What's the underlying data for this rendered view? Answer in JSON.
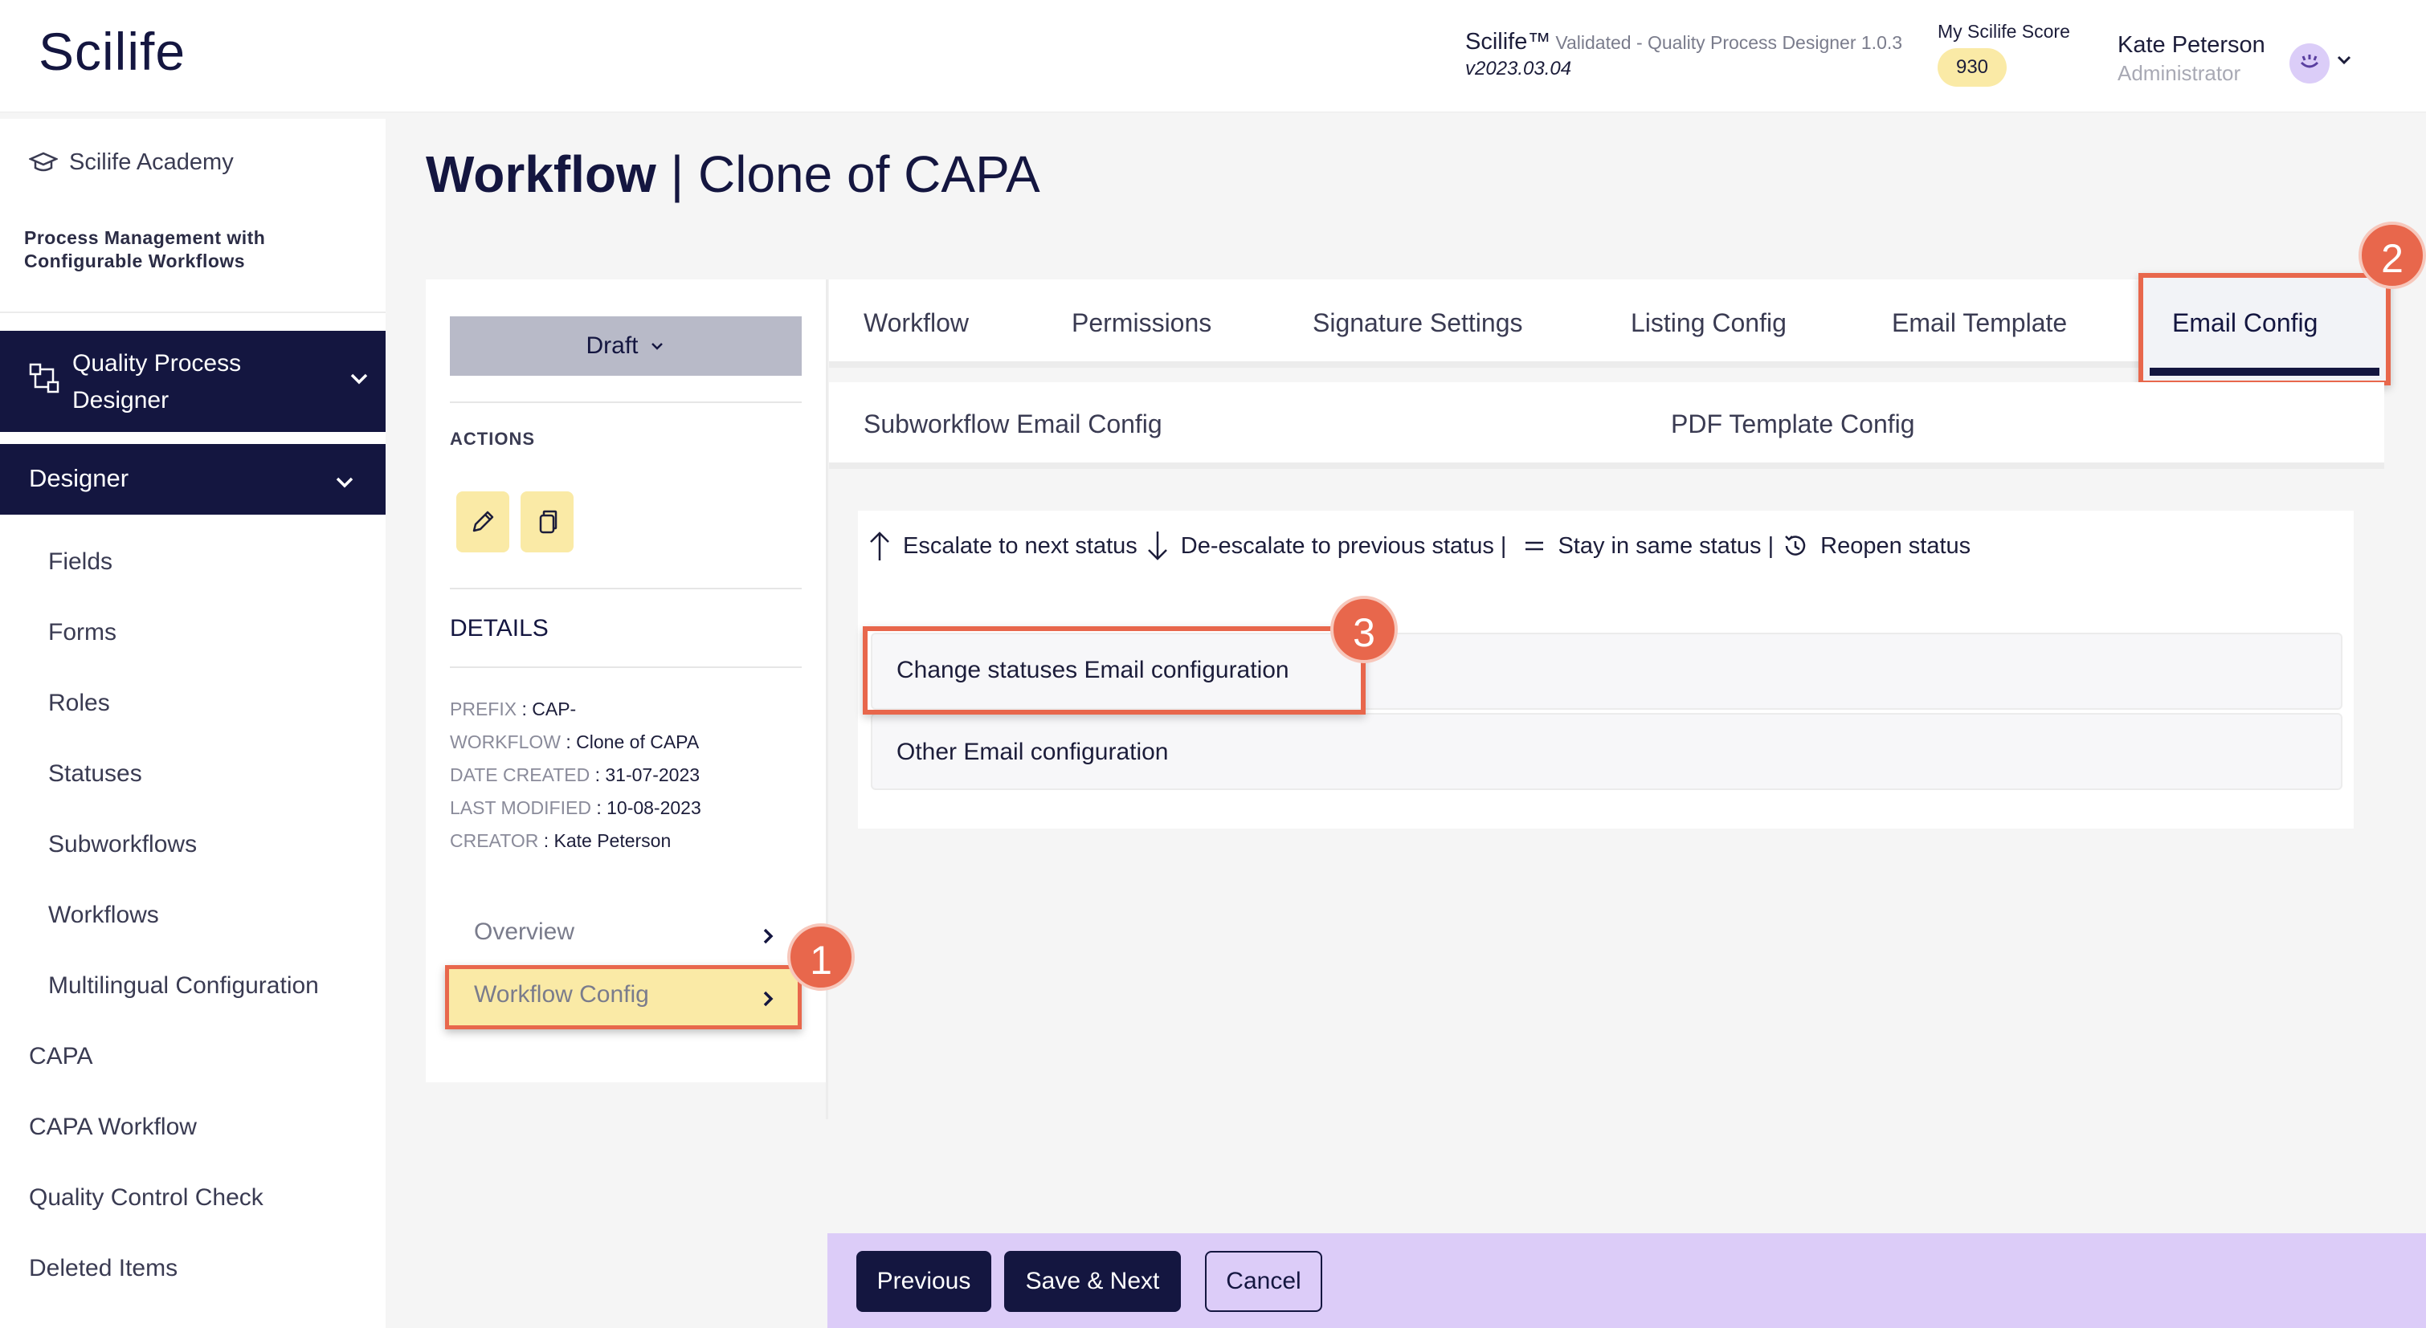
{
  "header": {
    "logo": "Scilife",
    "app_name": "Scilife™",
    "app_subtitle": "Validated - Quality Process Designer 1.0.3",
    "app_version": "v2023.03.04",
    "score_label": "My Scilife Score",
    "score_value": "930",
    "user_name": "Kate Peterson",
    "user_role": "Administrator"
  },
  "sidebar": {
    "academy": "Scilife Academy",
    "process_title": "Process Management with Configurable Workflows",
    "module": "Quality Process Designer",
    "section": "Designer",
    "items": [
      "Fields",
      "Forms",
      "Roles",
      "Statuses",
      "Subworkflows",
      "Workflows",
      "Multilingual Configuration",
      "CAPA",
      "CAPA Workflow",
      "Quality Control Check",
      "Deleted Items"
    ]
  },
  "page": {
    "title_bold": "Workflow",
    "title_sep": " | ",
    "title_rest": "Clone of CAPA"
  },
  "left_panel": {
    "status": "Draft",
    "actions_label": "ACTIONS",
    "details_label": "DETAILS",
    "details": [
      {
        "key": "PREFIX",
        "value": "CAP-"
      },
      {
        "key": "WORKFLOW",
        "value": "Clone of CAPA"
      },
      {
        "key": "DATE CREATED",
        "value": "31-07-2023"
      },
      {
        "key": "LAST MODIFIED",
        "value": "10-08-2023"
      },
      {
        "key": "CREATOR",
        "value": "Kate Peterson"
      }
    ],
    "nav": [
      "Overview",
      "Workflow Config"
    ]
  },
  "tabs": [
    "Workflow",
    "Permissions",
    "Signature Settings",
    "Listing Config",
    "Email Template",
    "Email Config"
  ],
  "subtabs": [
    "Subworkflow Email Config",
    "PDF Template Config"
  ],
  "legend": {
    "escalate": "Escalate to next status",
    "deescalate": "De-escalate to previous status |",
    "stay": "Stay in same status |",
    "reopen": "Reopen status"
  },
  "config_rows": [
    "Change statuses Email configuration",
    "Other Email configuration"
  ],
  "badges": [
    "1",
    "2",
    "3"
  ],
  "footer": {
    "previous": "Previous",
    "save_next": "Save & Next",
    "cancel": "Cancel"
  },
  "colors": {
    "navy": "#141640",
    "highlight_orange": "#e8674c",
    "yellow": "#faeaa6",
    "footer_lavender": "#dcccf8"
  }
}
